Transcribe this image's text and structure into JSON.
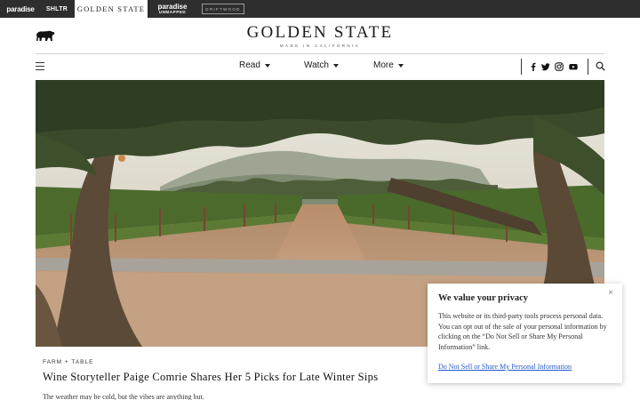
{
  "network_bar": {
    "paradise": "paradise",
    "shltr": "SHLTR",
    "golden_state": "GOLDEN STATE",
    "paradise_unmapped_top": "paradise",
    "paradise_unmapped_bottom": "UNMAPPED",
    "driftwood": "DRIFTWOOD"
  },
  "masthead": {
    "title": "GOLDEN STATE",
    "subtitle": "MADE IN CALIFORNIA"
  },
  "nav": {
    "items": [
      {
        "label": "Read"
      },
      {
        "label": "Watch"
      },
      {
        "label": "More"
      }
    ],
    "social": [
      "facebook-icon",
      "twitter-icon",
      "instagram-icon",
      "youtube-icon"
    ]
  },
  "article": {
    "kicker": "FARM + TABLE",
    "headline": "Wine Storyteller Paige Comrie Shares Her 5 Picks for Late Winter Sips",
    "dek": "The weather may be cold, but the vibes are anything but."
  },
  "privacy": {
    "title": "We value your privacy",
    "body": "This website or its third-party tools process personal data. You can opt out of the sale of your personal information by clicking on the “Do Not Sell or Share My Personal Information” link.",
    "link": "Do Not Sell or Share My Personal Information",
    "close": "×"
  }
}
